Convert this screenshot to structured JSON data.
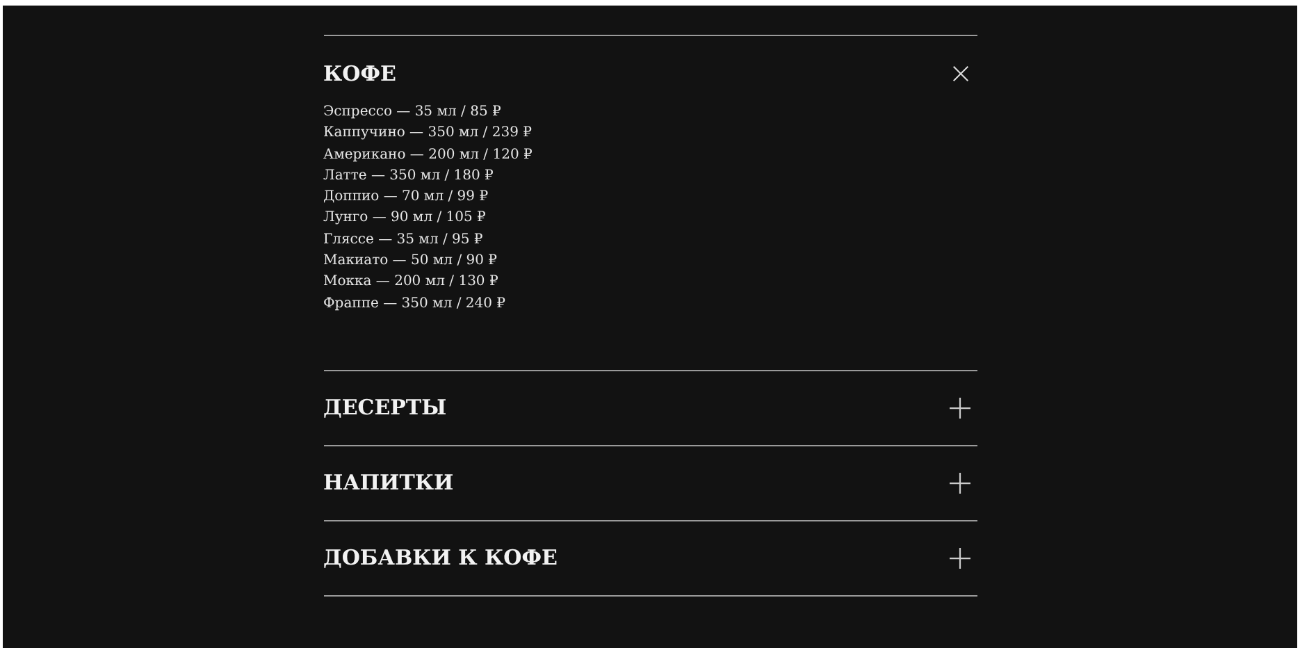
{
  "sections": [
    {
      "title": "КОФЕ",
      "expanded": true,
      "items": [
        "Эспрессо — 35 мл / 85 ₽",
        "Каппучино — 350 мл / 239 ₽",
        "Американо — 200 мл / 120 ₽",
        "Латте — 350 мл / 180 ₽",
        "Доппио — 70 мл / 99 ₽",
        "Лунго — 90 мл / 105 ₽",
        "Гляссе — 35 мл / 95 ₽",
        "Макиато — 50 мл / 90 ₽",
        "Мокка — 200 мл / 130 ₽",
        "Фраппе — 350 мл / 240 ₽"
      ]
    },
    {
      "title": "ДЕСЕРТЫ",
      "expanded": false
    },
    {
      "title": "НАПИТКИ",
      "expanded": false
    },
    {
      "title": "ДОБАВКИ К КОФЕ",
      "expanded": false
    }
  ]
}
